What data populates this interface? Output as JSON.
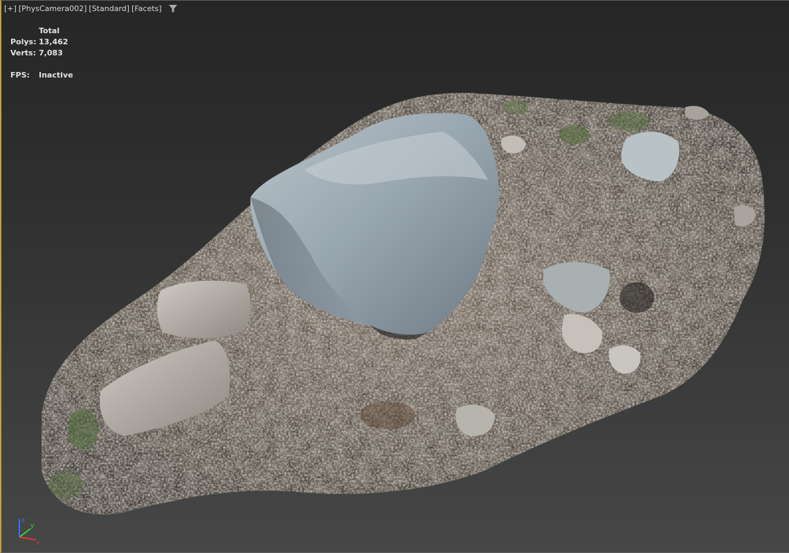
{
  "viewport": {
    "label_parts": [
      "[+]",
      "[PhysCamera002]",
      "[Standard]",
      "[Facets]"
    ],
    "filter_icon": "filter-funnel-icon"
  },
  "stats": {
    "header": "Total",
    "polys_label": "Polys:",
    "polys_value": "13,462",
    "verts_label": "Verts:",
    "verts_value": "7,083",
    "fps_label": "FPS:",
    "fps_value": "Inactive"
  },
  "axis_gizmo": {
    "x_label": "x",
    "y_label": "y",
    "z_label": "z",
    "x_color": "#e03a2a",
    "y_color": "#3ad13a",
    "z_color": "#3a6df0"
  },
  "colors": {
    "active_border": "#c9a13b",
    "bg_top": "#262626",
    "bg_bottom": "#474747"
  }
}
